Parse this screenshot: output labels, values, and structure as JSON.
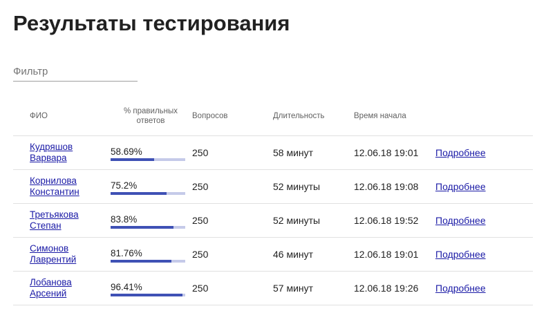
{
  "page": {
    "title": "Результаты тестирования"
  },
  "filter": {
    "placeholder": "Фильтр",
    "value": ""
  },
  "table": {
    "headers": {
      "name": "ФИО",
      "percent": "% правильных ответов",
      "questions": "Вопросов",
      "duration": "Длительность",
      "start_time": "Время начала"
    },
    "rows": [
      {
        "name": "Кудряшов Варвара",
        "percent_label": "58.69%",
        "percent_value": 58.69,
        "questions": "250",
        "duration": "58 минут",
        "start_time": "12.06.18 19:01",
        "details": "Подробнее"
      },
      {
        "name": "Корнилова Константин",
        "percent_label": "75.2%",
        "percent_value": 75.2,
        "questions": "250",
        "duration": "52 минуты",
        "start_time": "12.06.18 19:08",
        "details": "Подробнее"
      },
      {
        "name": "Третьякова Степан",
        "percent_label": "83.8%",
        "percent_value": 83.8,
        "questions": "250",
        "duration": "52 минуты",
        "start_time": "12.06.18 19:52",
        "details": "Подробнее"
      },
      {
        "name": "Симонов Лаврентий",
        "percent_label": "81.76%",
        "percent_value": 81.76,
        "questions": "250",
        "duration": "46 минут",
        "start_time": "12.06.18 19:01",
        "details": "Подробнее"
      },
      {
        "name": "Лобанова Арсений",
        "percent_label": "96.41%",
        "percent_value": 96.41,
        "questions": "250",
        "duration": "57 минут",
        "start_time": "12.06.18 19:26",
        "details": "Подробнее"
      }
    ]
  },
  "colors": {
    "progress_fill": "#3f51b5",
    "progress_track": "#c5cae9",
    "link": "#1a1aa6"
  }
}
